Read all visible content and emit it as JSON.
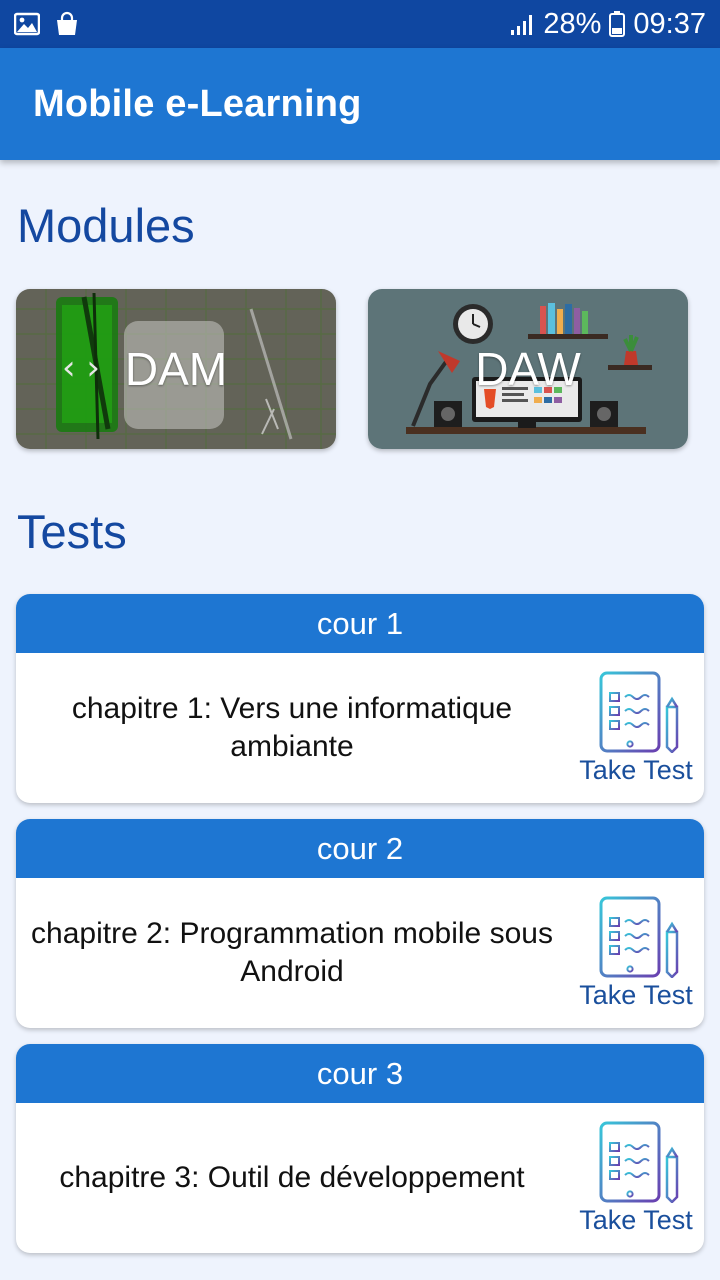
{
  "status_bar": {
    "battery": "28%",
    "time": "09:37",
    "icons": [
      "image-icon",
      "shopping-bag-icon",
      "signal-icon",
      "battery-icon"
    ]
  },
  "app_bar": {
    "title": "Mobile e-Learning"
  },
  "modules": {
    "title": "Modules",
    "items": [
      {
        "label": "DAM"
      },
      {
        "label": "DAW"
      }
    ]
  },
  "tests": {
    "title": "Tests",
    "items": [
      {
        "course": "cour 1",
        "chapter": "chapitre 1: Vers une informatique ambiante",
        "action": "Take Test"
      },
      {
        "course": "cour 2",
        "chapter": "chapitre 2: Programmation mobile sous Android",
        "action": "Take Test"
      },
      {
        "course": "cour 3",
        "chapter": "chapitre 3: Outil de développement",
        "action": "Take Test"
      }
    ]
  },
  "colors": {
    "status_bar": "#0f47a1",
    "app_bar": "#1e76d2",
    "heading": "#1448a0",
    "background": "#eef3fd",
    "link": "#1a4f9c"
  }
}
